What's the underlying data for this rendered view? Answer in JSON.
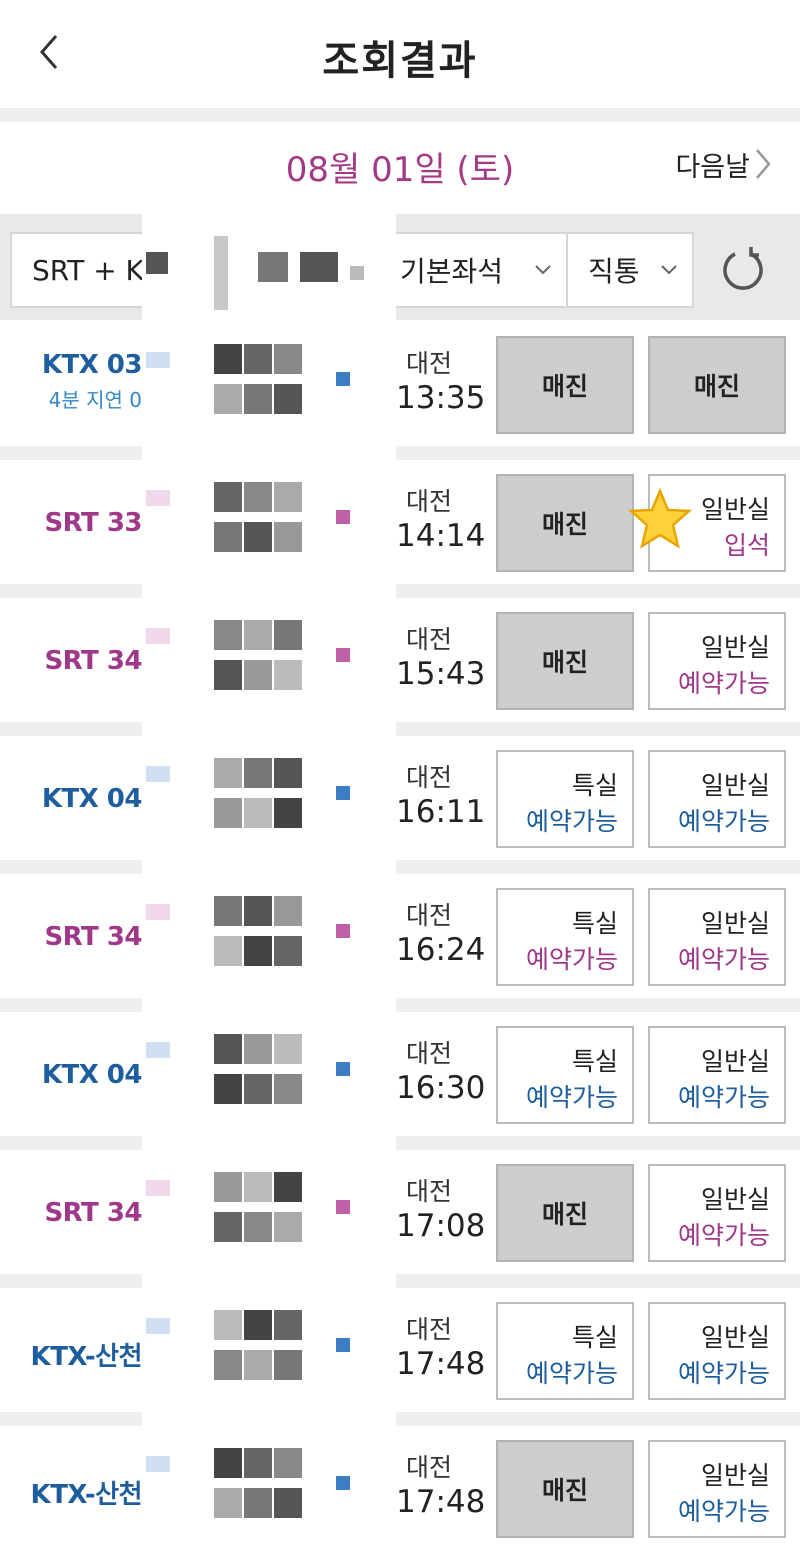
{
  "header": {
    "title": "조회결과"
  },
  "datebar": {
    "date": "08월 01일 (토)",
    "next_day": "다음날"
  },
  "filters": {
    "train_type": "SRT + K",
    "seat": "기본좌석",
    "direct": "직통"
  },
  "colors": {
    "srt": "#a0388a",
    "ktx": "#1e5e9e",
    "soldout_bg": "#cdcdcd"
  },
  "icons": {
    "back": "chevron-left-icon",
    "next": "chevron-right-icon",
    "refresh": "refresh-icon",
    "favorite": "star-icon"
  },
  "rows": [
    {
      "train": "KTX 03",
      "kind": "ktx",
      "delay": "4분 지연 0",
      "dep_station": "대전",
      "dep_time": "13:35",
      "seat1": {
        "sold": true,
        "label": "매진"
      },
      "seat2": {
        "sold": true,
        "label": "매진"
      }
    },
    {
      "train": "SRT 33",
      "kind": "srt",
      "dep_station": "대전",
      "dep_time": "14:14",
      "seat1": {
        "sold": true,
        "label": "매진"
      },
      "seat2": {
        "sold": false,
        "class": "일반실",
        "status": "입석"
      },
      "starred": true
    },
    {
      "train": "SRT 34",
      "kind": "srt",
      "dep_station": "대전",
      "dep_time": "15:43",
      "seat1": {
        "sold": true,
        "label": "매진"
      },
      "seat2": {
        "sold": false,
        "class": "일반실",
        "status": "예약가능"
      }
    },
    {
      "train": "KTX 04",
      "kind": "ktx",
      "dep_station": "대전",
      "dep_time": "16:11",
      "seat1": {
        "sold": false,
        "class": "특실",
        "status": "예약가능"
      },
      "seat2": {
        "sold": false,
        "class": "일반실",
        "status": "예약가능"
      }
    },
    {
      "train": "SRT 34",
      "kind": "srt",
      "dep_station": "대전",
      "dep_time": "16:24",
      "seat1": {
        "sold": false,
        "class": "특실",
        "status": "예약가능"
      },
      "seat2": {
        "sold": false,
        "class": "일반실",
        "status": "예약가능"
      }
    },
    {
      "train": "KTX 04",
      "kind": "ktx",
      "dep_station": "대전",
      "dep_time": "16:30",
      "seat1": {
        "sold": false,
        "class": "특실",
        "status": "예약가능"
      },
      "seat2": {
        "sold": false,
        "class": "일반실",
        "status": "예약가능"
      }
    },
    {
      "train": "SRT 34",
      "kind": "srt",
      "dep_station": "대전",
      "dep_time": "17:08",
      "seat1": {
        "sold": true,
        "label": "매진"
      },
      "seat2": {
        "sold": false,
        "class": "일반실",
        "status": "예약가능"
      }
    },
    {
      "train": "KTX-산천",
      "kind": "ktx",
      "dep_station": "대전",
      "dep_time": "17:48",
      "seat1": {
        "sold": false,
        "class": "특실",
        "status": "예약가능"
      },
      "seat2": {
        "sold": false,
        "class": "일반실",
        "status": "예약가능"
      }
    },
    {
      "train": "KTX-산천",
      "kind": "ktx",
      "dep_station": "대전",
      "dep_time": "17:48",
      "seat1": {
        "sold": true,
        "label": "매진"
      },
      "seat2": {
        "sold": false,
        "class": "일반실",
        "status": "예약가능"
      }
    }
  ]
}
